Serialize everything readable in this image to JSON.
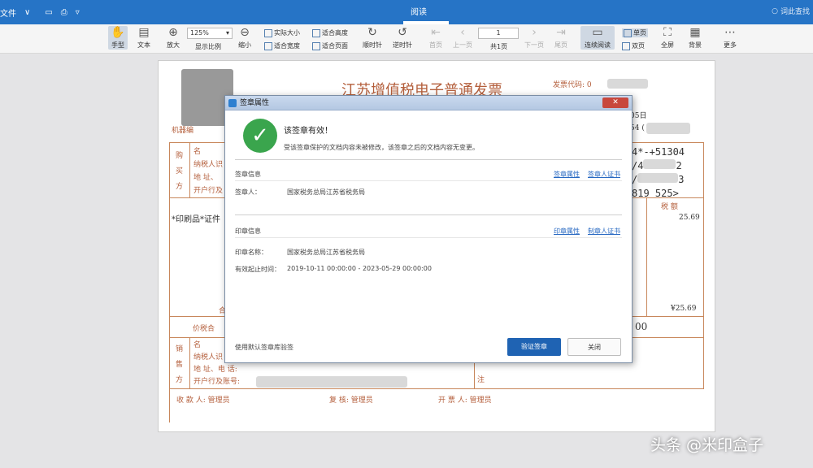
{
  "titlebar": {
    "file_menu": "文件",
    "active_tab": "阅读",
    "search_placeholder": "词此查找",
    "bg_color": "#2674c6"
  },
  "toolbar": {
    "hand": "手型",
    "text": "文本",
    "zoom_in": "放大",
    "zoom_value": "125%",
    "zoom_label": "显示比例",
    "zoom_out": "缩小",
    "actual_size": "实际大小",
    "fit_height": "适合高度",
    "fit_width": "适合宽度",
    "fit_page": "适合页面",
    "rotate_cw": "顺时针",
    "rotate_ccw": "逆时针",
    "first_page": "首页",
    "prev_page": "上一页",
    "page_value": "1",
    "page_total": "共1页",
    "next_page": "下一页",
    "last_page": "尾页",
    "continuous": "连续阅读",
    "single": "单页",
    "double": "双页",
    "fullscreen": "全屏",
    "background": "背景",
    "more": "更多"
  },
  "invoice": {
    "title": "江苏增值税电子普通发票",
    "code_label": "发票代码: 0",
    "date_fragment": "05日",
    "num_fragment": "54 (",
    "machine_label": "机器编",
    "buyer": [
      "购",
      "买",
      "方"
    ],
    "buyer_fields": [
      "名",
      "纳税人识",
      "地 址、",
      "开户行及"
    ],
    "cipher": [
      "4*-+51304",
      "/4",
      "2",
      "/",
      "3",
      "819",
      "525>"
    ],
    "item": "*印刷品*证件",
    "tax_header": "税 额",
    "tax_value": "25.69",
    "total_tax": "¥25.69",
    "total_prefix": "合",
    "price_tax_label": "价税合",
    "price_tax_value": "00",
    "seller": [
      "销",
      "售",
      "方"
    ],
    "seller_fields": [
      "名",
      "纳税人识",
      "地 址、电 话:",
      "开户行及账号:"
    ],
    "note": "注",
    "payee": "收 款 人: 管理员",
    "reviewer": "复 核: 管理员",
    "drawer": "开 票 人: 管理员"
  },
  "dialog": {
    "title": "签章属性",
    "close": "✕",
    "status_title": "该签章有效！",
    "status_desc": "受该签章保护的文档内容未被修改，该签章之后的文档内容无变更。",
    "sig_section": "签章信息",
    "sig_link1": "签章属性",
    "sig_link2": "签章人证书",
    "signer_label": "签章人：",
    "signer_value": "国家税务总局江苏省税务局",
    "seal_section": "印章信息",
    "seal_link1": "印章属性",
    "seal_link2": "制章人证书",
    "seal_name_label": "印章名称：",
    "seal_name_value": "国家税务总局江苏省税务局",
    "validity_label": "有效起止时间：",
    "validity_value": "2019-10-11 00:00:00 - 2023-05-29 00:00:00",
    "footer_text": "使用默认签章库验签",
    "verify_btn": "验证签章",
    "close_btn": "关闭",
    "accent": "#1f63b3",
    "success_color": "#3aa54d"
  },
  "watermark": "头条 @米印盒子"
}
